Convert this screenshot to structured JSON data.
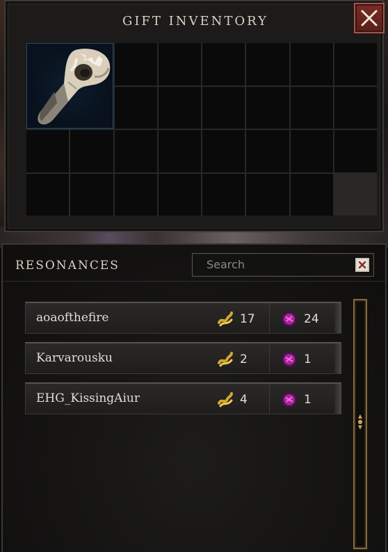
{
  "gift_inventory": {
    "title": "GIFT INVENTORY",
    "close_icon": "close-icon",
    "items": [
      {
        "name_icon": "bird-skull-icon"
      }
    ]
  },
  "resonances": {
    "title": "RESONANCES",
    "search": {
      "placeholder": "Search",
      "clear_icon": "clear-icon"
    },
    "rows": [
      {
        "name": "aoaofthefire",
        "gold": "17",
        "obsidian": "24"
      },
      {
        "name": "Karvarousku",
        "gold": "2",
        "obsidian": "1"
      },
      {
        "name": "EHG_KissingAiur",
        "gold": "4",
        "obsidian": "1"
      }
    ]
  },
  "colors": {
    "accent_gold": "#c9a45a",
    "close_red": "#7a2c24",
    "resonance_purple": "#a0289a"
  }
}
